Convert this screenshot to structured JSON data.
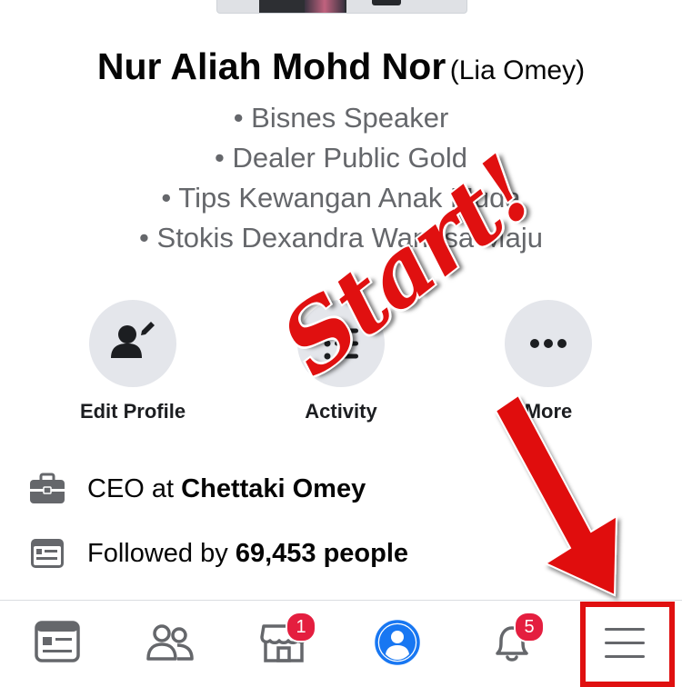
{
  "profile": {
    "name": "Nur Aliah Mohd Nor",
    "alternate_name": "(Lia Omey)",
    "bio": [
      "• Bisnes Speaker",
      "• Dealer Public Gold",
      "• Tips Kewangan Anak Muda",
      "• Stokis Dexandra Wangsa Maju"
    ]
  },
  "actions": [
    {
      "label": "Edit Profile",
      "icon": "edit-profile-icon"
    },
    {
      "label": "Activity",
      "icon": "activity-list-icon"
    },
    {
      "label": "More",
      "icon": "more-icon"
    }
  ],
  "info": {
    "work": {
      "prefix": "CEO at ",
      "value": "Chettaki Omey",
      "icon": "briefcase-icon"
    },
    "followers": {
      "prefix": "Followed by ",
      "value": "69,453 people",
      "icon": "followers-feed-icon"
    }
  },
  "tabbar": {
    "tabs": [
      {
        "name": "news-feed",
        "icon": "news-feed-icon"
      },
      {
        "name": "friends",
        "icon": "friends-icon"
      },
      {
        "name": "marketplace",
        "icon": "marketplace-icon",
        "badge": "1"
      },
      {
        "name": "profile",
        "icon": "profile-icon",
        "active": true
      },
      {
        "name": "notifications",
        "icon": "bell-icon",
        "badge": "5"
      },
      {
        "name": "menu",
        "icon": "hamburger-menu-icon"
      }
    ]
  },
  "annotation": {
    "text": "Start!",
    "color": "#e01010"
  },
  "colors": {
    "accent": "#1877f2",
    "badge": "#e41e3f",
    "annotation": "#e01010",
    "icon_gray": "#65676b"
  }
}
